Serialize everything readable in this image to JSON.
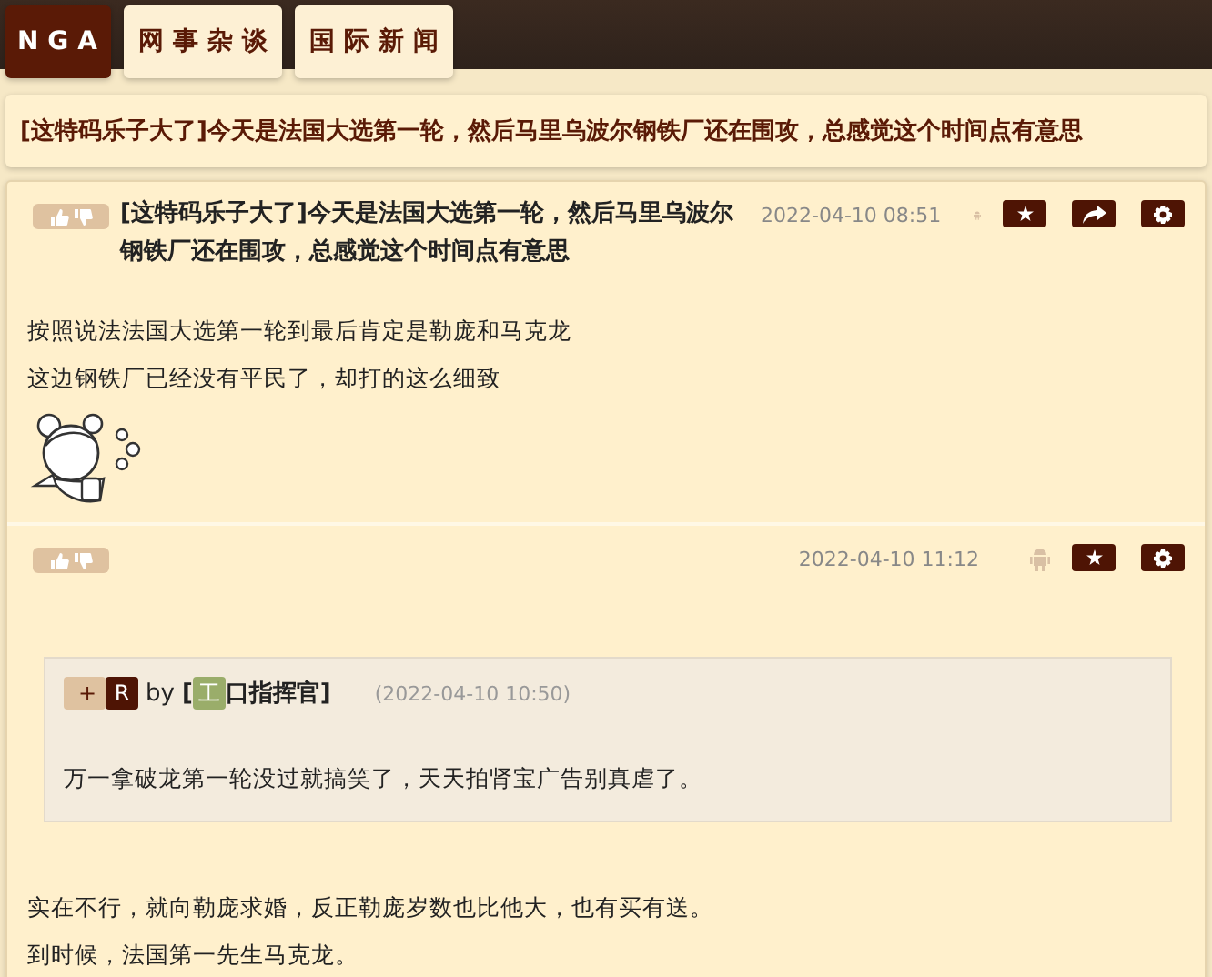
{
  "nav": {
    "tabs": [
      {
        "label": "NGA",
        "kind": "logo"
      },
      {
        "label": "网事杂谈",
        "kind": "link"
      },
      {
        "label": "国际新闻",
        "kind": "link"
      }
    ]
  },
  "thread_title": "[这特码乐子大了]今天是法国大选第一轮，然后马里乌波尔钢铁厂还在围攻，总感觉这个时间点有意思",
  "posts": [
    {
      "title": "[这特码乐子大了]今天是法国大选第一轮，然后马里乌波尔钢铁厂还在围攻，总感觉这个时间点有意思",
      "time": "2022-04-10 08:51",
      "actions": [
        {
          "kind": "star"
        },
        {
          "kind": "share"
        },
        {
          "kind": "settings"
        }
      ],
      "paragraphs": [
        "按照说法法国大选第一轮到最后肯定是勒庞和马克龙",
        "这边钢铁厂已经没有平民了，却打的这么细致"
      ],
      "sticker": {
        "kind": "picture"
      }
    },
    {
      "time": "2022-04-10 11:12",
      "actions": [
        {
          "kind": "star"
        },
        {
          "kind": "settings"
        }
      ],
      "quote": {
        "plus": "+",
        "reply_badge": "R",
        "by": "by",
        "user_prefix": "[",
        "user_icon": "工",
        "user_name": "口指挥官]",
        "time": "(2022-04-10 10:50)",
        "text": "万一拿破龙第一轮没过就搞笑了，天天拍肾宝广告别真虐了。"
      },
      "paragraphs": [
        "实在不行，就向勒庞求婚，反正勒庞岁数也比他大，也有买有送。",
        "到时候，法国第一先生马克龙。"
      ]
    }
  ]
}
